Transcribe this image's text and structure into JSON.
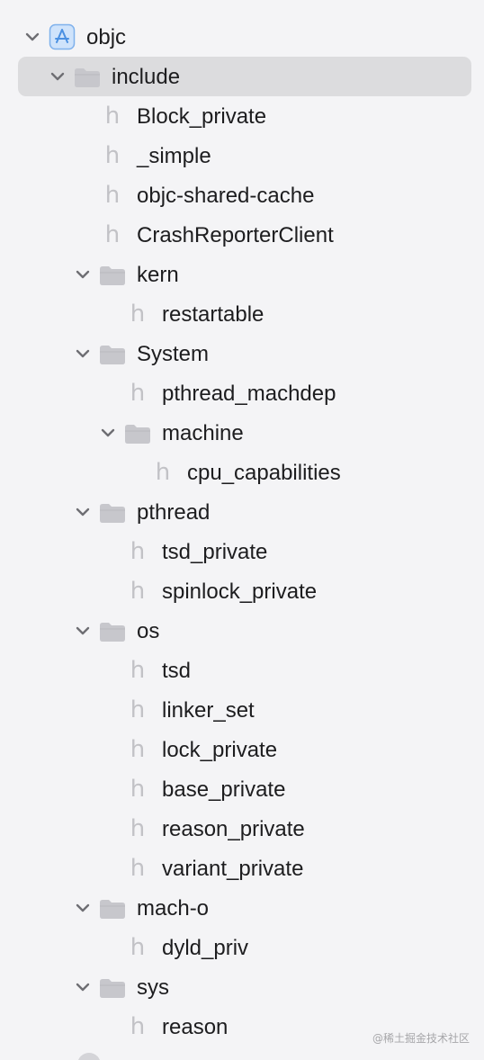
{
  "navigator": {
    "selected": "include",
    "rows": [
      {
        "label": "objc",
        "kind": "project",
        "expanded": true
      },
      {
        "label": "include",
        "kind": "folder",
        "expanded": true,
        "selected": true
      },
      {
        "label": "Block_private",
        "kind": "header"
      },
      {
        "label": "_simple",
        "kind": "header"
      },
      {
        "label": "objc-shared-cache",
        "kind": "header"
      },
      {
        "label": "CrashReporterClient",
        "kind": "header"
      },
      {
        "label": "kern",
        "kind": "folder",
        "expanded": true
      },
      {
        "label": "restartable",
        "kind": "header"
      },
      {
        "label": "System",
        "kind": "folder",
        "expanded": true
      },
      {
        "label": "pthread_machdep",
        "kind": "header"
      },
      {
        "label": "machine",
        "kind": "folder",
        "expanded": true
      },
      {
        "label": "cpu_capabilities",
        "kind": "header"
      },
      {
        "label": "pthread",
        "kind": "folder",
        "expanded": true
      },
      {
        "label": "tsd_private",
        "kind": "header"
      },
      {
        "label": "spinlock_private",
        "kind": "header"
      },
      {
        "label": "os",
        "kind": "folder",
        "expanded": true
      },
      {
        "label": "tsd",
        "kind": "header"
      },
      {
        "label": "linker_set",
        "kind": "header"
      },
      {
        "label": "lock_private",
        "kind": "header"
      },
      {
        "label": "base_private",
        "kind": "header"
      },
      {
        "label": "reason_private",
        "kind": "header"
      },
      {
        "label": "variant_private",
        "kind": "header"
      },
      {
        "label": "mach-o",
        "kind": "folder",
        "expanded": true
      },
      {
        "label": "dyld_priv",
        "kind": "header"
      },
      {
        "label": "sys",
        "kind": "folder",
        "expanded": true
      },
      {
        "label": "reason",
        "kind": "header"
      }
    ]
  },
  "icons": {
    "header_glyph": "h",
    "header_icon": "header-file-icon",
    "folder_icon": "folder-icon",
    "project_icon": "app-project-icon",
    "chevron": "chevron-down-icon"
  },
  "colors": {
    "background": "#f4f4f6",
    "selection": "#dcdcde",
    "folder": "#c7c7cc",
    "chevron": "#6e6e73",
    "header_glyph": "#c2c2c6",
    "project_icon_fill": "#cfe3fb",
    "project_icon_stroke": "#4a90e2"
  },
  "watermark": "@稀土掘金技术社区"
}
